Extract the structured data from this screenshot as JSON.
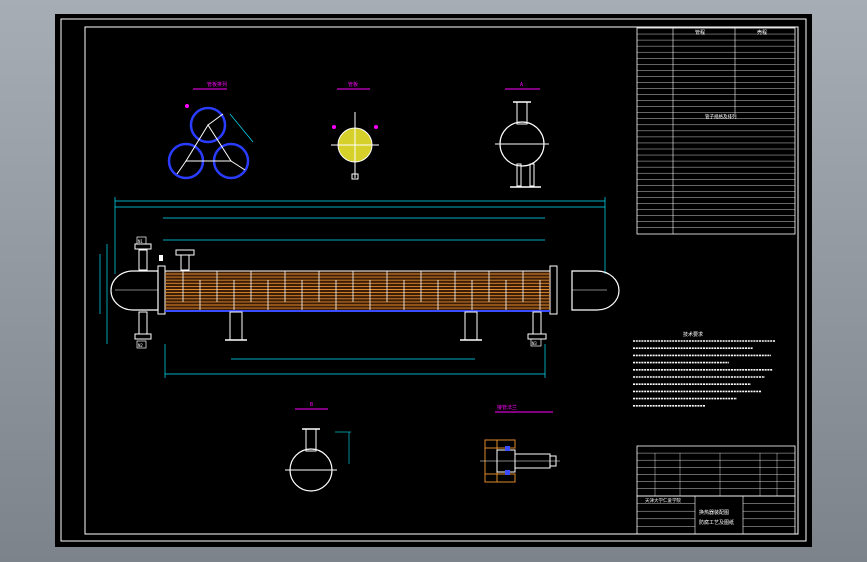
{
  "drawing": {
    "tech_table": {
      "headers": [
        "管程",
        "壳程"
      ],
      "rows": 18,
      "section_title": "管子规格及排列"
    },
    "notes_title": "技术要求",
    "notes_count": 10,
    "title_block": {
      "school": "天津大学仁爱学院",
      "drawing_name": "换热器装配图",
      "drawing_sub": "防腐工艺及图纸"
    },
    "views": {
      "tube_layout": "管板排列",
      "tubesheet": "管板",
      "end_view": "A",
      "nozzle_section": "B",
      "flange_detail": "接管法兰"
    },
    "nozzle_tags": [
      "N1",
      "N2",
      "N3"
    ],
    "colors": {
      "frame": "#ffffff",
      "dimension": "#00e5ff",
      "label": "#ff00ff",
      "tubes": "#e08a2c",
      "shell": "#ffffff",
      "tubesheet_fill": "#d6d02a",
      "tube_circles": "#2a3cff",
      "bottom_line": "#3a4cff"
    }
  }
}
